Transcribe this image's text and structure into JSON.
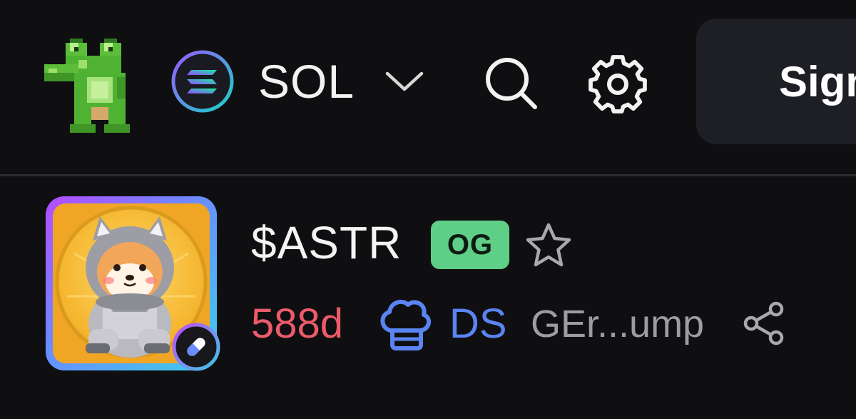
{
  "header": {
    "logo_icon": "pixel-frog-logo",
    "chain": {
      "label": "SOL",
      "icon": "solana-icon",
      "dropdown_icon": "chevron-down-icon"
    },
    "search_icon": "search-icon",
    "settings_icon": "gear-icon",
    "sign_in_label": "Sign"
  },
  "token": {
    "avatar_icon": "astronaut-shiba-avatar",
    "edit_icon": "pill-icon",
    "name": "$ASTR",
    "badge": "OG",
    "favorite_icon": "star-icon",
    "age": "588d",
    "dev_icon": "chef-hat-icon",
    "dev_tag": "DS",
    "address": "GEr...ump",
    "share_icon": "share-icon"
  },
  "colors": {
    "background": "#0f0f12",
    "og_badge": "#5fce86",
    "age": "#ec5b6a",
    "dev_tag": "#5a84f2",
    "address": "#9c9ca3"
  }
}
